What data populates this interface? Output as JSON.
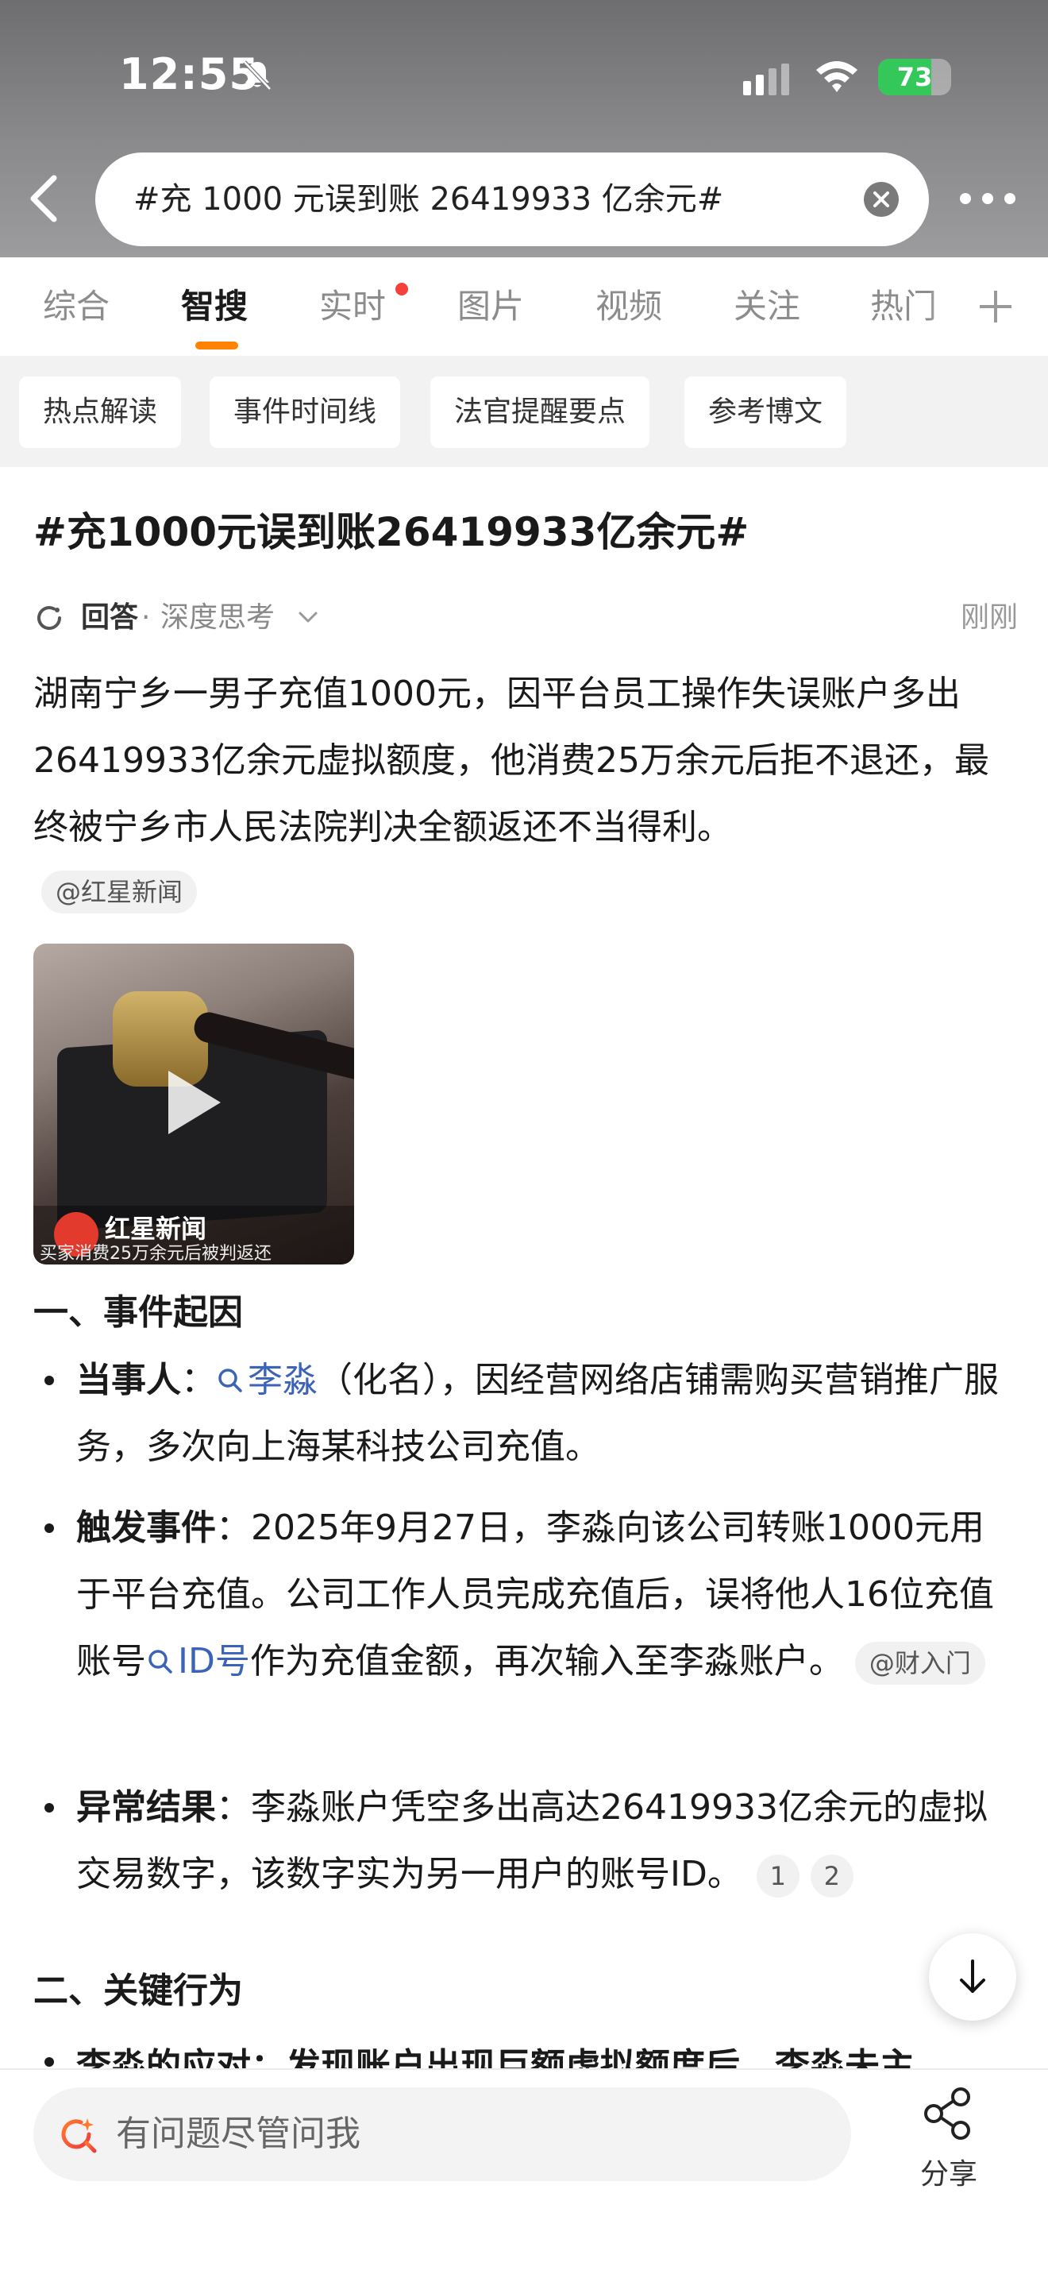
{
  "status_bar": {
    "time": "12:55",
    "battery": "73",
    "battery_level": 0.73
  },
  "search": {
    "query": "#充 1000 元误到账 26419933 亿余元#"
  },
  "tabs": [
    {
      "label": "综合"
    },
    {
      "label": "智搜"
    },
    {
      "label": "实时"
    },
    {
      "label": "图片"
    },
    {
      "label": "视频"
    },
    {
      "label": "关注"
    },
    {
      "label": "热门"
    }
  ],
  "active_tab": "智搜",
  "chips": [
    "热点解读",
    "事件时间线",
    "法官提醒要点",
    "参考博文"
  ],
  "content": {
    "title": "#充1000元误到账26419933亿余元#",
    "answer_label": "回答",
    "answer_sep": "·",
    "answer_mode": "深度思考",
    "answer_time": "刚刚",
    "summary": "湖南宁乡一男子充值1000元，因平台员工操作失误账户多出26419933亿余元虚拟额度，他消费25万余元后拒不退还，最终被宁乡市人民法院判决全额返还不当得利。",
    "summary_source": "@红星新闻",
    "video_caption": "红星新闻",
    "video_subcaption": "买家消费25万余元后被判返还",
    "section1": "一、事件起因",
    "bullets": [
      {
        "label": "当事人",
        "colon": "：",
        "link": "李淼",
        "text": "（化名），因经营网络店铺需购买营销推广服务，多次向上海某科技公司充值。"
      },
      {
        "label": "触发事件",
        "colon": "：",
        "text_a": "2025年9月27日，李淼向该公司转账1000元用于平台充值。公司工作人员完成充值后，误将他人16位充值账号",
        "link": "ID号",
        "text_b": "作为充值金额，再次输入至李淼账户。",
        "source": "@财入门"
      },
      {
        "label": "异常结果",
        "colon": "：",
        "text": "李淼账户凭空多出高达26419933亿余元的虚拟交易数字，该数字实为另一用户的账号ID。",
        "refs": [
          "1",
          "2"
        ]
      }
    ],
    "section2": "二、关键行为",
    "cut_line": "李淼的应对：发现账户出现巨额虚拟额度后，李淼未主"
  },
  "bottom": {
    "ask_placeholder": "有问题尽管问我",
    "share_label": "分享"
  },
  "colors": {
    "accent": "#ff8200",
    "link": "#3b63b8",
    "battery": "#34c759",
    "notification_dot": "#f5413b"
  }
}
